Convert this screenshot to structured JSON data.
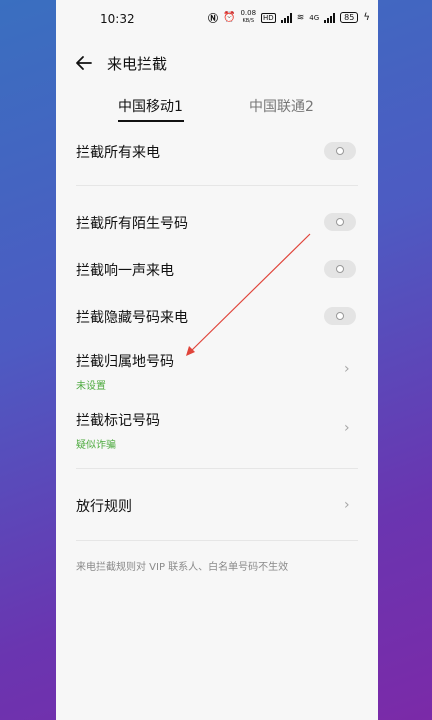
{
  "statusbar": {
    "time": "10:32",
    "network_speed_top": "0.08",
    "network_speed_bottom": "KB/S",
    "hd": "HD",
    "net_type": "4G",
    "battery": "85"
  },
  "header": {
    "title": "来电拦截"
  },
  "tabs": [
    {
      "label": "中国移动1",
      "active": true
    },
    {
      "label": "中国联通2",
      "active": false
    }
  ],
  "settings": {
    "block_all": "拦截所有来电",
    "block_unknown": "拦截所有陌生号码",
    "block_one_ring": "拦截响一声来电",
    "block_hidden": "拦截隐藏号码来电",
    "block_region": {
      "label": "拦截归属地号码",
      "sub": "未设置"
    },
    "block_marked": {
      "label": "拦截标记号码",
      "sub": "疑似诈骗"
    },
    "allow_rules": "放行规则"
  },
  "toggles": {
    "block_all": false,
    "block_unknown": false,
    "block_one_ring": false,
    "block_hidden": false
  },
  "note": "来电拦截规则对 VIP 联系人、白名单号码不生效",
  "colors": {
    "accent_green": "#4caa3e",
    "annotation_arrow": "#e0443a"
  }
}
